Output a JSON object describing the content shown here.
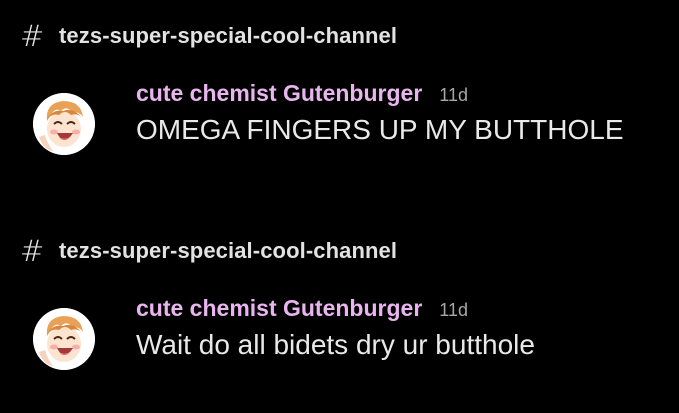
{
  "colors": {
    "background": "#000000",
    "channel_text": "#e2e2e2",
    "username": "#e8b5ee",
    "timestamp": "#a7a7a7",
    "message_text": "#e9e9e9"
  },
  "mentions": [
    {
      "channel": {
        "icon": "hash-icon",
        "hash": "#",
        "name": "tezs-super-special-cool-channel"
      },
      "message": {
        "avatar_icon": "anime-avatar",
        "author": "cute chemist Gutenburger",
        "timestamp": "11d",
        "content": "OMEGA FINGERS UP MY BUTTHOLE"
      }
    },
    {
      "channel": {
        "icon": "hash-icon",
        "hash": "#",
        "name": "tezs-super-special-cool-channel"
      },
      "message": {
        "avatar_icon": "anime-avatar",
        "author": "cute chemist Gutenburger",
        "timestamp": "11d",
        "content": "Wait do all bidets dry ur butthole"
      }
    }
  ]
}
